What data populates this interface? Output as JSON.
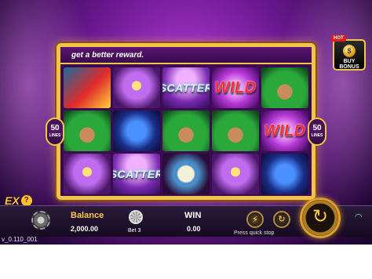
{
  "marquee": {
    "text": "get a better reward."
  },
  "reels": [
    [
      {
        "symbol": "parrot",
        "label": ""
      },
      {
        "symbol": "queen",
        "label": ""
      },
      {
        "symbol": "mask",
        "label": ""
      }
    ],
    [
      {
        "symbol": "mask",
        "label": ""
      },
      {
        "symbol": "drums",
        "label": ""
      },
      {
        "symbol": "scatter",
        "label": "SCATTER"
      }
    ],
    [
      {
        "symbol": "scatter",
        "label": "SCATTER"
      },
      {
        "symbol": "queen",
        "label": ""
      },
      {
        "symbol": "tambourine",
        "label": ""
      }
    ],
    [
      {
        "symbol": "wild",
        "label": "WILD"
      },
      {
        "symbol": "queen",
        "label": ""
      },
      {
        "symbol": "mask",
        "label": ""
      }
    ],
    [
      {
        "symbol": "queen",
        "label": ""
      },
      {
        "symbol": "wild",
        "label": "WILD"
      },
      {
        "symbol": "drums",
        "label": ""
      }
    ]
  ],
  "lines": {
    "count": "50",
    "unit": "LINES"
  },
  "buy_bonus": {
    "hot": "HOT",
    "label": "BUY BONUS",
    "coin": "$"
  },
  "ex_badge": {
    "label": "EX",
    "help": "?"
  },
  "bottom": {
    "balance_label": "Balance",
    "balance_value": "2,000.00",
    "bet_label": "Bet 3",
    "win_label": "WIN",
    "win_value": "0.00",
    "quick_stop": "Press quick stop",
    "bolt": "⚡",
    "auto": "↻",
    "spin": "↻"
  },
  "version": "v_0.110_001",
  "colors": {
    "accent": "#f1c44a",
    "background": "#6a1890",
    "wild": "#ff2a3a"
  }
}
